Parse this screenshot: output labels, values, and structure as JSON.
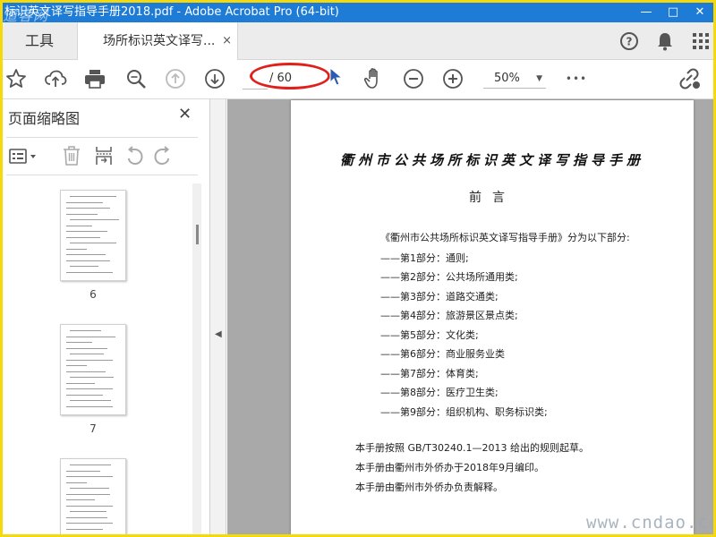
{
  "window": {
    "title": "标识英文译写指导手册2018.pdf - Adobe Acrobat Pro (64-bit)",
    "logo_text": "道客网",
    "controls": [
      "—",
      "□",
      "✕"
    ]
  },
  "tabs": {
    "tools_label": "工具",
    "document_label": "场所标识英文译写...",
    "close_glyph": "×"
  },
  "toolbar": {
    "page_current": "",
    "page_total": "/ 60",
    "zoom_value": "50%",
    "more_glyph": "•••"
  },
  "panel": {
    "title": "页面缩略图",
    "close_glyph": "✕",
    "thumbnails": [
      {
        "page": "6"
      },
      {
        "page": "7"
      },
      {
        "page": ""
      }
    ]
  },
  "document": {
    "heading": "衢州市公共场所标识英文译写指导手册",
    "preface": "前言",
    "intro": "《衢州市公共场所标识英文译写指导手册》分为以下部分:",
    "parts": [
      "——第1部分：通则;",
      "——第2部分：公共场所通用类;",
      "——第3部分：道路交通类;",
      "——第4部分：旅游景区景点类;",
      "——第5部分：文化类;",
      "——第6部分：商业服务业类",
      "——第7部分：体育类;",
      "——第8部分：医疗卫生类;",
      "——第9部分：组织机构、职务标识类;"
    ],
    "notes": [
      "本手册按照  GB/T30240.1—2013  给出的规则起草。",
      "本手册由衢州市外侨办于2018年9月编印。",
      "本手册由衢州市外侨办负责解释。"
    ]
  },
  "watermark": "www.cndao.com",
  "colors": {
    "titlebar": "#1e7bd6",
    "highlight_ellipse": "#e0201b",
    "outer_border": "#f5d90a"
  }
}
